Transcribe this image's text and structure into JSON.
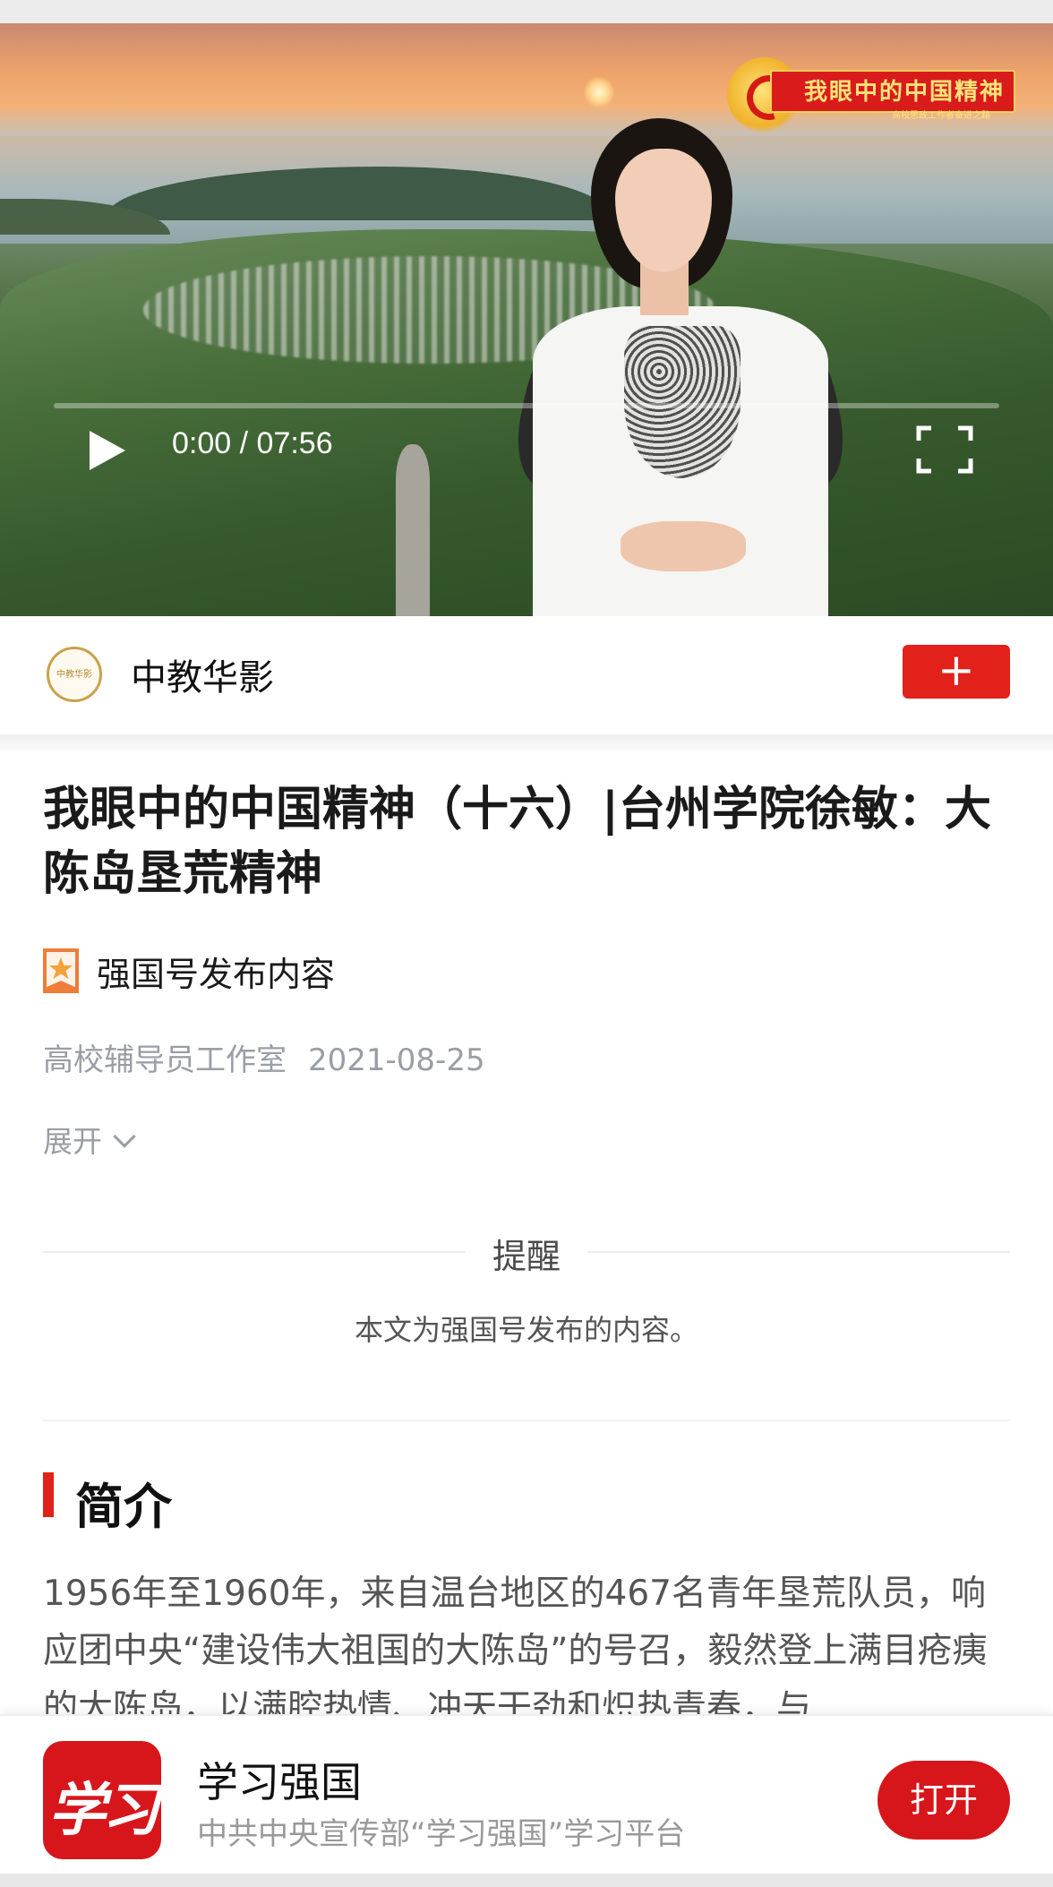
{
  "video": {
    "current_time": "0:00",
    "separator": " / ",
    "duration": "07:56",
    "progress_fraction": 0.0,
    "banner_title": "我眼中的中国精神",
    "banner_subtitle": "高校思政工作者奋进之路"
  },
  "channel": {
    "logo_text": "中教华影",
    "name": "中教华影",
    "follow_label": "+"
  },
  "article": {
    "title": "我眼中的中国精神（十六）|台州学院徐敏：大陈岛垦荒精神",
    "badge_text": "强国号发布内容",
    "author": "高校辅导员工作室",
    "date": "2021-08-25",
    "expand_label": "展开"
  },
  "notice": {
    "title": "提醒",
    "body": "本文为强国号发布的内容。"
  },
  "intro": {
    "heading": "简介",
    "text": "1956年至1960年，来自温台地区的467名青年垦荒队员，响应团中央“建设伟大祖国的大陈岛”的号召，毅然登上满目疮痍的大陈岛，以满腔热情、冲天干劲和炽热青春，与"
  },
  "app_bar": {
    "icon_text": "学习",
    "name": "学习强国",
    "subtitle": "中共中央宣传部“学习强国”学习平台",
    "open_label": "打开"
  },
  "colors": {
    "accent_red": "#e1211a",
    "app_red": "#d7161c",
    "meta_gray": "#9a9ea4"
  }
}
